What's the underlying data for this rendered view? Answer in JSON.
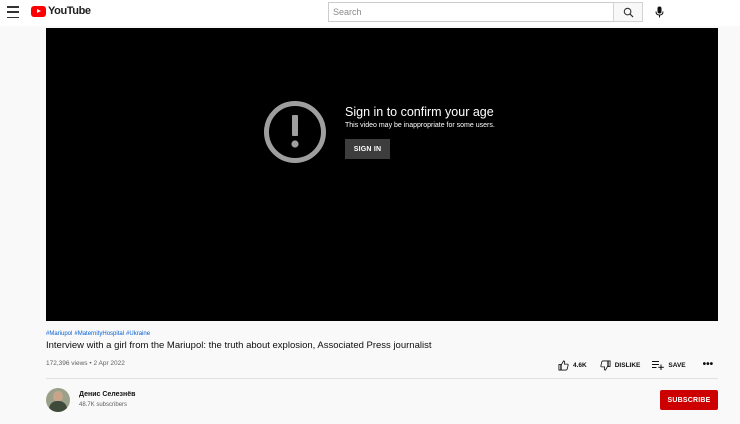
{
  "header": {
    "logo_text": "YouTube",
    "search_placeholder": "Search"
  },
  "player": {
    "age_title": "Sign in to confirm your age",
    "age_subtitle": "This video may be inappropriate for some users.",
    "signin_label": "SIGN IN"
  },
  "video": {
    "hashtags": [
      "#Mariupol",
      "#MaternityHospital",
      "#Ukraine"
    ],
    "title": "Interview with a girl from the Mariupol: the truth about explosion, Associated Press journalist",
    "meta": "172,396 views • 2 Apr 2022",
    "likes": "4.6K",
    "dislike_label": "DISLIKE",
    "save_label": "SAVE",
    "more_label": "•••"
  },
  "channel": {
    "name": "Денис Селезнёв",
    "subscribers": "48.7K subscribers",
    "subscribe_label": "SUBSCRIBE"
  },
  "colors": {
    "brand_red": "#ff0000",
    "subscribe_red": "#cc0000",
    "link_blue": "#065fd4"
  }
}
